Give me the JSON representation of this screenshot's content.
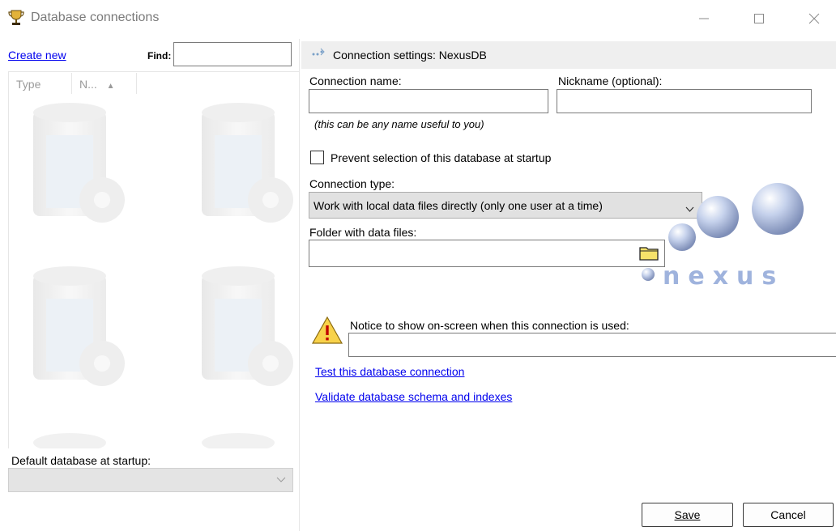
{
  "window": {
    "title": "Database connections",
    "controls": [
      "minimize",
      "maximize",
      "close"
    ]
  },
  "left_panel": {
    "create_new": "Create new",
    "find_label": "Find:",
    "find_value": "",
    "columns": [
      "Type",
      "N...",
      "▲"
    ],
    "default_label": "Default database at startup:",
    "default_value": ""
  },
  "right_panel": {
    "header_title": "Connection settings: NexusDB",
    "connection_name_label": "Connection name:",
    "connection_name_value": "",
    "nickname_label": "Nickname (optional):",
    "nickname_value": "",
    "connection_hint": "(this can be any name useful to you)",
    "prevent_label": "Prevent selection of this database at startup",
    "prevent_checked": false,
    "connection_type_label": "Connection type:",
    "connection_type_value": "Work with local data files directly (only one user at a time)",
    "folder_label": "Folder with data files:",
    "folder_value": "",
    "logo_text": "nexus",
    "notice_label": "Notice to show on-screen when this connection is used:",
    "notice_value": "",
    "test_link": "Test this database connection",
    "validate_link": "Validate database schema and indexes"
  },
  "buttons": {
    "save": "Save",
    "cancel": "Cancel"
  },
  "icons": {
    "app": "trophy-icon",
    "connection": "connection-icon",
    "folder": "folder-icon",
    "warning": "warning-icon",
    "dropdown": "chevron-down-icon"
  },
  "colors": {
    "link": "#0000ee",
    "header_bg": "#efefef",
    "disabled_bg": "#e4e4e4",
    "logo_blue": "#9fb3dd"
  }
}
